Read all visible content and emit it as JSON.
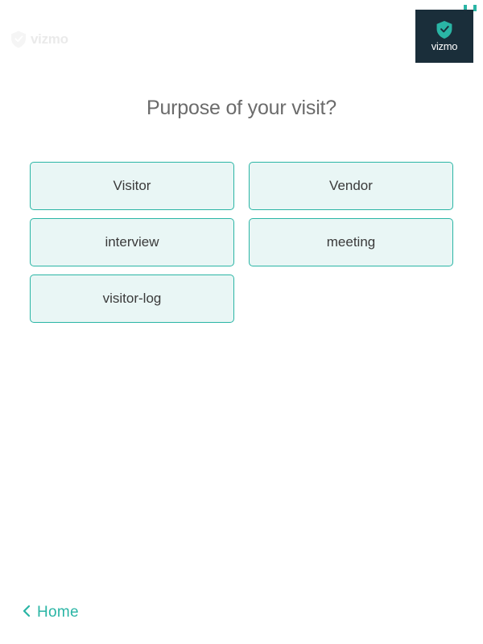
{
  "brand": {
    "name": "vizmo"
  },
  "page": {
    "title": "Purpose of your visit?"
  },
  "options": [
    {
      "label": "Visitor"
    },
    {
      "label": "Vendor"
    },
    {
      "label": "interview"
    },
    {
      "label": "meeting"
    },
    {
      "label": "visitor-log"
    }
  ],
  "footer": {
    "home_label": "Home"
  },
  "colors": {
    "accent": "#2ab5a5",
    "option_bg": "#e9f6f5",
    "badge_bg": "#1a2e3a"
  }
}
